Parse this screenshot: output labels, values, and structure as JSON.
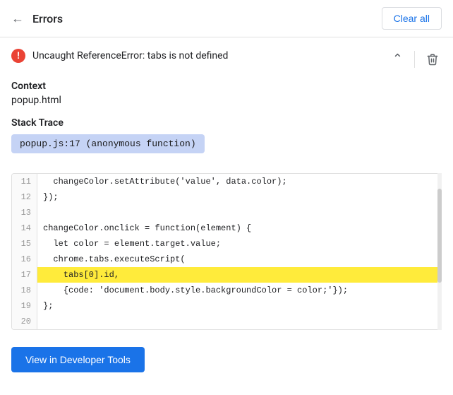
{
  "header": {
    "back_label": "←",
    "title": "Errors",
    "clear_all_label": "Clear all"
  },
  "error": {
    "icon_label": "!",
    "message": "Uncaught ReferenceError: tabs is not defined"
  },
  "context_section": {
    "label": "Context",
    "value": "popup.html"
  },
  "stack_trace_section": {
    "label": "Stack Trace",
    "pill": "popup.js:17 (anonymous function)"
  },
  "code_lines": [
    {
      "number": "11",
      "code": "  changeColor.setAttribute('value', data.color);",
      "highlight": false
    },
    {
      "number": "12",
      "code": "});",
      "highlight": false
    },
    {
      "number": "13",
      "code": "",
      "highlight": false
    },
    {
      "number": "14",
      "code": "changeColor.onclick = function(element) {",
      "highlight": false
    },
    {
      "number": "15",
      "code": "  let color = element.target.value;",
      "highlight": false
    },
    {
      "number": "16",
      "code": "  chrome.tabs.executeScript(",
      "highlight": false
    },
    {
      "number": "17",
      "code": "    tabs[0].id,",
      "highlight": true
    },
    {
      "number": "18",
      "code": "    {code: 'document.body.style.backgroundColor = color;'});",
      "highlight": false
    },
    {
      "number": "19",
      "code": "};",
      "highlight": false
    },
    {
      "number": "20",
      "code": "",
      "highlight": false
    }
  ],
  "view_button": {
    "label": "View in Developer Tools"
  }
}
